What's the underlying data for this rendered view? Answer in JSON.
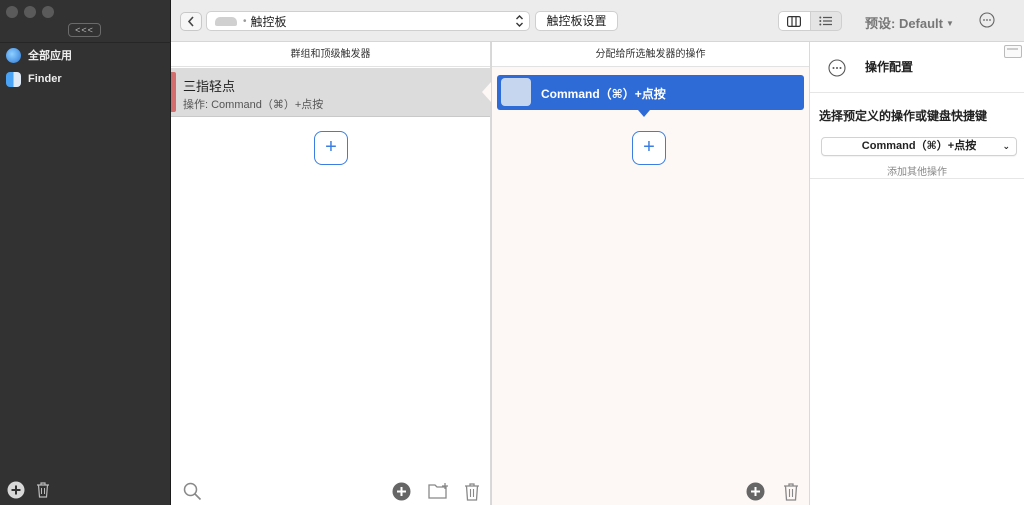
{
  "sidebar": {
    "collapse_label": "<<<",
    "items": [
      {
        "label": "全部应用",
        "icon": "globe-icon"
      },
      {
        "label": "Finder",
        "icon": "finder-icon"
      }
    ]
  },
  "toolbar": {
    "device_label": "触控板",
    "device_dot": "•",
    "settings_label": "触控板设置",
    "preset_label": "预设: Default"
  },
  "columns": {
    "triggers": {
      "header": "群组和顶级触发器",
      "items": [
        {
          "title": "三指轻点",
          "subtitle": "操作: Command（⌘）+点按"
        }
      ]
    },
    "actions": {
      "header": "分配给所选触发器的操作",
      "items": [
        {
          "label": "Command（⌘）+点按"
        }
      ]
    }
  },
  "config": {
    "title": "操作配置",
    "section_label": "选择预定义的操作或键盘快捷键",
    "selected_action": "Command（⌘）+点按",
    "add_more": "添加其他操作"
  },
  "colors": {
    "accent": "#2e6bd6",
    "add_outline": "#3b7de0",
    "sidebar_bg": "#323232",
    "trigger_stripe": "#d46e6e"
  }
}
